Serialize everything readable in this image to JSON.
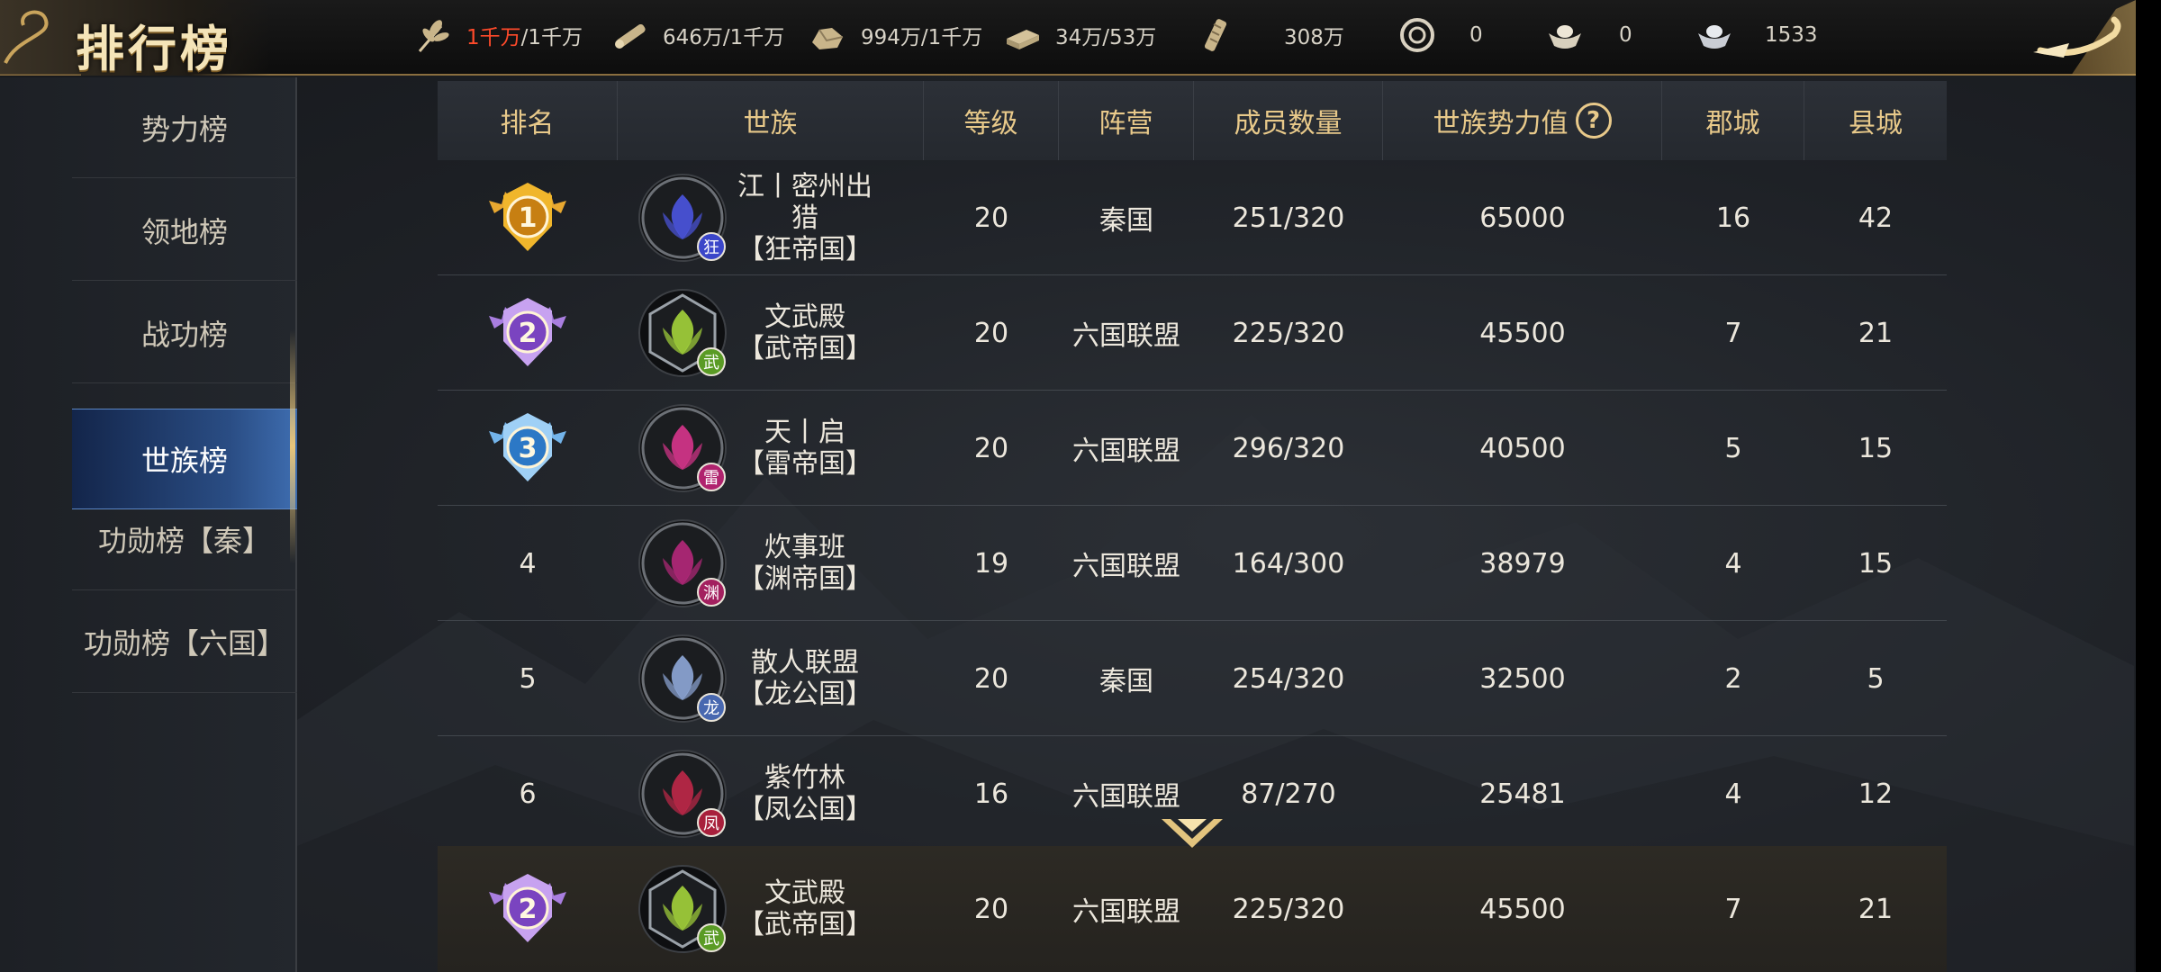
{
  "header": {
    "title": "排行榜",
    "resources": [
      {
        "icon": "grain-icon",
        "current": "1千万",
        "max": "/1千万",
        "full": true
      },
      {
        "icon": "wood-icon",
        "current": "646万/1千万"
      },
      {
        "icon": "stone-icon",
        "current": "994万/1千万"
      },
      {
        "icon": "iron-icon",
        "current": "34万/53万"
      },
      {
        "icon": "tax-scroll-icon",
        "current": "308万"
      },
      {
        "icon": "copper-coin-icon",
        "current": "0"
      },
      {
        "icon": "gold-ingot-icon",
        "current": "0"
      },
      {
        "icon": "silver-ingot-icon",
        "current": "1533"
      }
    ]
  },
  "sidebar": {
    "items": [
      {
        "label": "势力榜",
        "active": false
      },
      {
        "label": "领地榜",
        "active": false
      },
      {
        "label": "战功榜",
        "active": false
      },
      {
        "label": "世族榜",
        "active": true
      },
      {
        "label": "功勋榜【秦】",
        "active": false
      },
      {
        "label": "功勋榜【六国】",
        "active": false
      }
    ]
  },
  "table": {
    "headers": {
      "rank": "排名",
      "clan": "世族",
      "level": "等级",
      "faction": "阵营",
      "members": "成员数量",
      "power": "世族势力值",
      "power_help": "?",
      "commanderies": "郡城",
      "counties": "县城"
    },
    "rows": [
      {
        "rank": "1",
        "medal": "gold",
        "clan_line1": "江丨密州出猎",
        "clan_line2": "【狂帝国】",
        "emblem_char": "狂",
        "emblem_icon": "lotus-icon",
        "emblem_color": "#4b55e0",
        "badge_color": "#3b46c9",
        "level": "20",
        "faction": "秦国",
        "members": "251/320",
        "power": "65000",
        "commanderies": "16",
        "counties": "42"
      },
      {
        "rank": "2",
        "medal": "purple",
        "clan_line1": "文武殿",
        "clan_line2": "【武帝国】",
        "emblem_char": "武",
        "emblem_icon": "phoenix-wing-icon",
        "emblem_color": "#a4d43a",
        "badge_color": "#5a9b25",
        "level": "20",
        "faction": "六国联盟",
        "members": "225/320",
        "power": "45500",
        "commanderies": "7",
        "counties": "21"
      },
      {
        "rank": "3",
        "medal": "blue",
        "clan_line1": "天丨启",
        "clan_line2": "【雷帝国】",
        "emblem_char": "雷",
        "emblem_icon": "dragon-icon",
        "emblem_color": "#d8358c",
        "badge_color": "#b0236e",
        "level": "20",
        "faction": "六国联盟",
        "members": "296/320",
        "power": "40500",
        "commanderies": "5",
        "counties": "15"
      },
      {
        "rank": "4",
        "medal": "",
        "clan_line1": "炊事班",
        "clan_line2": "【渊帝国】",
        "emblem_char": "渊",
        "emblem_icon": "flame-icon",
        "emblem_color": "#b5287a",
        "badge_color": "#a3205f",
        "level": "19",
        "faction": "六国联盟",
        "members": "164/300",
        "power": "38979",
        "commanderies": "4",
        "counties": "15"
      },
      {
        "rank": "5",
        "medal": "",
        "clan_line1": "散人联盟",
        "clan_line2": "【龙公国】",
        "emblem_char": "龙",
        "emblem_icon": "dragon-head-icon",
        "emblem_color": "#8fa8d8",
        "badge_color": "#4868b0",
        "level": "20",
        "faction": "秦国",
        "members": "254/320",
        "power": "32500",
        "commanderies": "2",
        "counties": "5"
      },
      {
        "rank": "6",
        "medal": "",
        "clan_line1": "紫竹林",
        "clan_line2": "【凤公国】",
        "emblem_char": "凤",
        "emblem_icon": "phoenix-icon",
        "emblem_color": "#c02848",
        "badge_color": "#a8203c",
        "level": "16",
        "faction": "六国联盟",
        "members": "87/270",
        "power": "25481",
        "commanderies": "4",
        "counties": "12"
      }
    ],
    "self_row": {
      "rank": "2",
      "medal": "purple",
      "clan_line1": "文武殿",
      "clan_line2": "【武帝国】",
      "emblem_char": "武",
      "emblem_icon": "phoenix-wing-icon",
      "emblem_color": "#a4d43a",
      "badge_color": "#5a9b25",
      "level": "20",
      "faction": "六国联盟",
      "members": "225/320",
      "power": "45500",
      "commanderies": "7",
      "counties": "21"
    }
  },
  "colors": {
    "gold_text": "#e8c98a",
    "full_resource": "#ff4a2a",
    "active_tab": "#2a4d84",
    "medal_gold": "#f0b62c",
    "medal_purple": "#9a63d6",
    "medal_blue": "#4f9ee0"
  }
}
